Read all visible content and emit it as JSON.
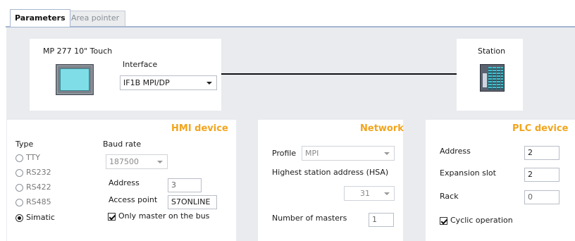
{
  "tabs": [
    {
      "label": "Parameters",
      "active": true
    },
    {
      "label": "Area pointer",
      "active": false
    }
  ],
  "hmi": {
    "title": "MP 277 10\" Touch",
    "interface_label": "Interface",
    "interface_value": "IF1B MPI/DP",
    "icon": "hmi-touch-panel-icon"
  },
  "station": {
    "title": "Station",
    "icon": "plc-station-icon"
  },
  "hmi_device": {
    "section_title": "HMI device",
    "type_label": "Type",
    "types": [
      {
        "label": "TTY",
        "selected": false
      },
      {
        "label": "RS232",
        "selected": false
      },
      {
        "label": "RS422",
        "selected": false
      },
      {
        "label": "RS485",
        "selected": false
      },
      {
        "label": "Simatic",
        "selected": true
      }
    ],
    "baud_rate_label": "Baud rate",
    "baud_rate_value": "187500",
    "address_label": "Address",
    "address_value": "3",
    "access_point_label": "Access point",
    "access_point_value": "S7ONLINE",
    "only_master_label": "Only master on the bus",
    "only_master_checked": true
  },
  "network": {
    "section_title": "Network",
    "profile_label": "Profile",
    "profile_value": "MPI",
    "hsa_label": "Highest station address (HSA)",
    "hsa_value": "31",
    "masters_label": "Number of masters",
    "masters_value": "1"
  },
  "plc_device": {
    "section_title": "PLC device",
    "address_label": "Address",
    "address_value": "2",
    "expansion_label": "Expansion slot",
    "expansion_value": "2",
    "rack_label": "Rack",
    "rack_value": "0",
    "cyclic_label": "Cyclic operation",
    "cyclic_checked": true
  },
  "colors": {
    "section_title": "#f2a51c",
    "background": "#e9ebef",
    "tab_border": "#a7b6cf"
  }
}
